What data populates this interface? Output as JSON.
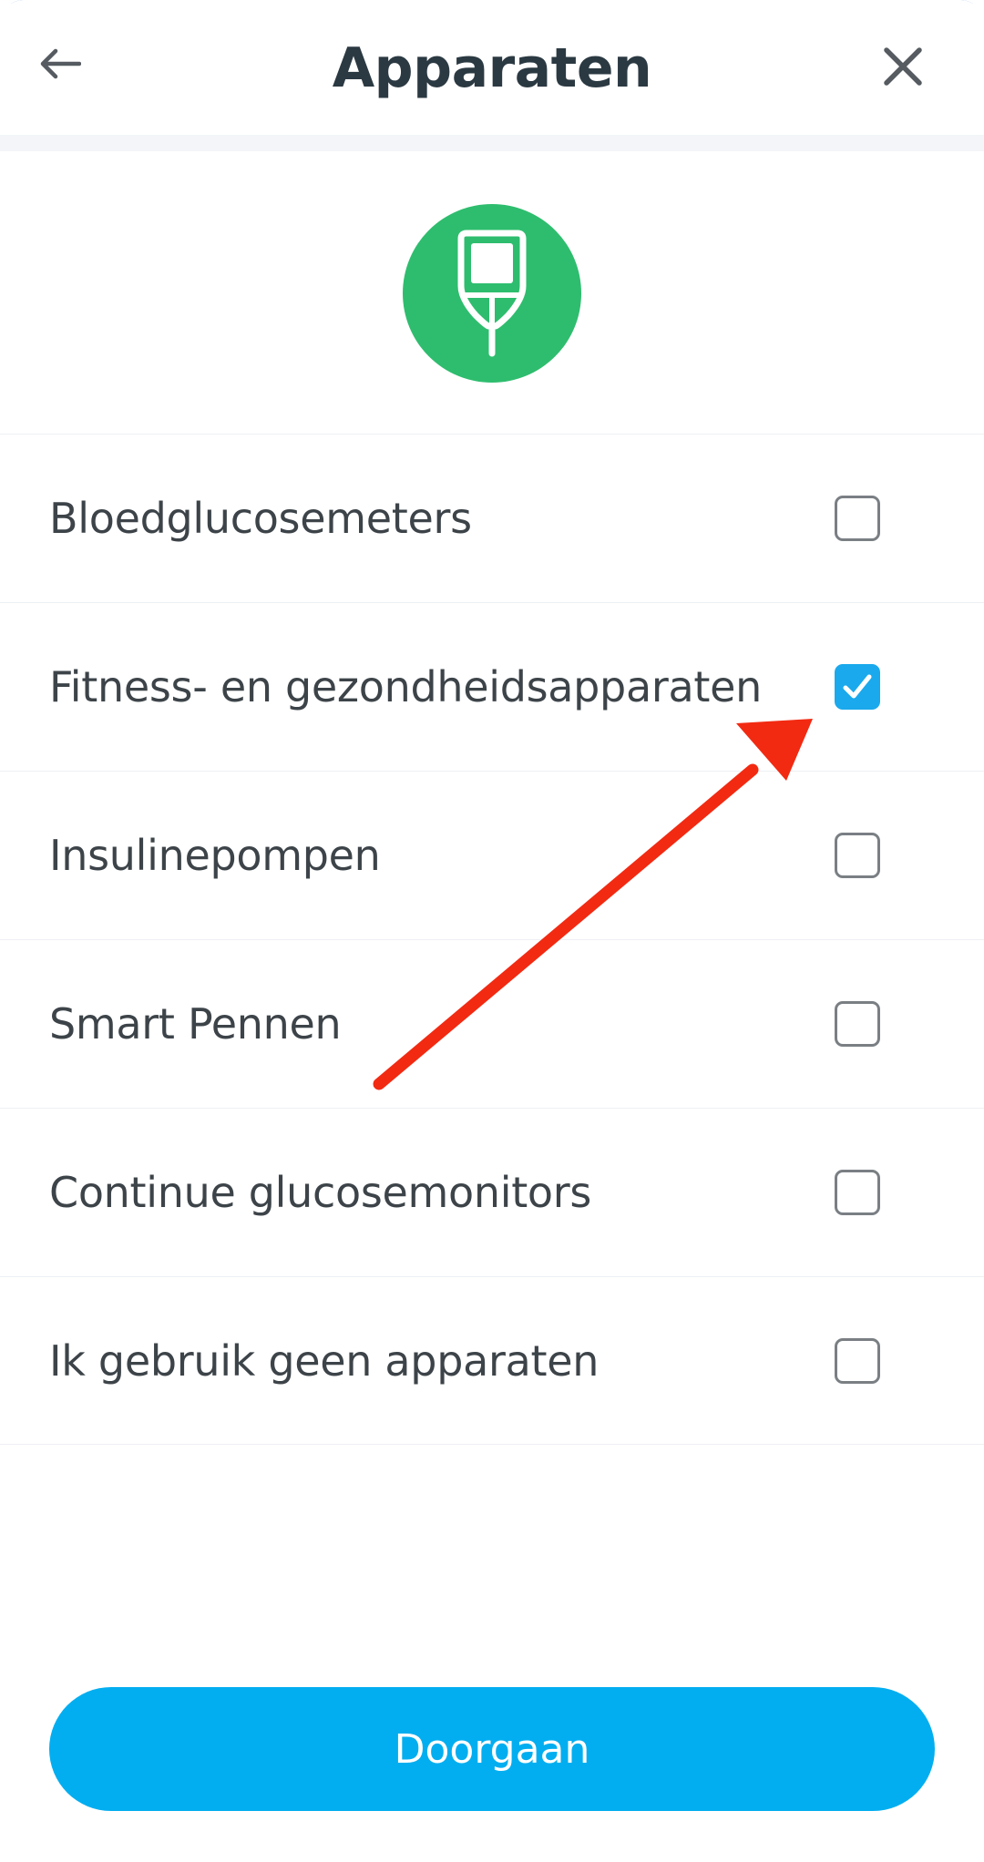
{
  "header": {
    "title": "Apparaten",
    "back_icon": "arrow-left-icon",
    "close_icon": "close-icon"
  },
  "badge": {
    "icon": "glucose-meter-icon",
    "color": "#2ebd6e"
  },
  "devices": [
    {
      "label": "Bloedglucosemeters",
      "checked": false
    },
    {
      "label": "Fitness- en gezondheidsapparaten",
      "checked": true
    },
    {
      "label": "Insulinepompen",
      "checked": false
    },
    {
      "label": "Smart Pennen",
      "checked": false
    },
    {
      "label": "Continue glucosemonitors",
      "checked": false
    },
    {
      "label": "Ik gebruik geen apparaten",
      "checked": false
    }
  ],
  "footer": {
    "continue_label": "Doorgaan"
  },
  "colors": {
    "accent": "#03aef0",
    "checkbox_checked": "#1aa9ec",
    "annotation_arrow": "#f22a12"
  }
}
